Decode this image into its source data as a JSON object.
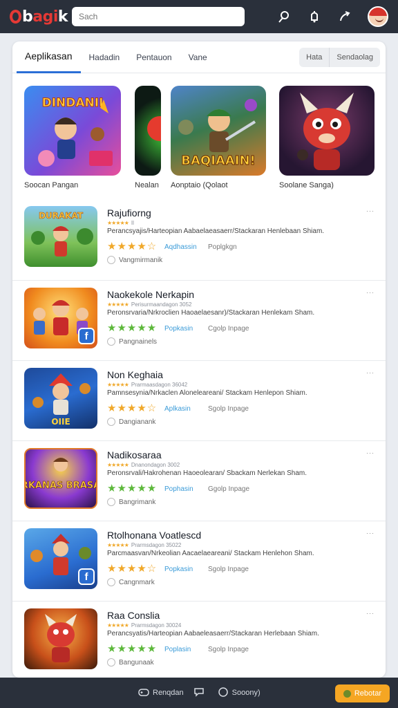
{
  "header": {
    "logo_prefix": "b",
    "logo_red": "agi",
    "logo_suffix": "k",
    "search_placeholder": "Sach",
    "icons": [
      "location-pin-icon",
      "notification-bell-icon",
      "share-arrow-icon",
      "avatar"
    ]
  },
  "tabs": [
    "Aeplikasan",
    "Hadadin",
    "Pentauon",
    "Vane"
  ],
  "active_tab": 0,
  "view_toggle": [
    "Hata",
    "Sendaolag"
  ],
  "featured": [
    {
      "caption": "Soocan Pangan",
      "art_text": "DINDANII"
    },
    {
      "caption": "Nealan",
      "art_text": ""
    },
    {
      "caption": "Aonptaio (Qolaot",
      "art_text": "BAQIAAIN!"
    },
    {
      "caption": "Soolane Sanga)",
      "art_text": ""
    }
  ],
  "apps": [
    {
      "title": "Rajufiorng",
      "sub": "Il",
      "description": "Perancsyajis/Harteopian Aabaelaeasaerr/Stackaran Henlebaan Shiam.",
      "stars": "★★★★☆",
      "star_color": "#f0a82a",
      "category": "Aqdhassin",
      "extra": "Poplgkgn",
      "developer": "Vangmirmanik",
      "more": "···",
      "thumb_text": "DURAKAT",
      "badge": ""
    },
    {
      "title": "Naokekole Nerkapin",
      "sub": "Perisurmaandagon 3052",
      "description": "Peronsrvaria/Nrkroclien Haoaelaesanr)/Stackaran Henlekam Sham.",
      "stars": "★★★★★",
      "star_color": "#5cb83a",
      "category": "Popkasin",
      "extra": "Cgolp Inpage",
      "developer": "Pangnainels",
      "more": "···",
      "thumb_text": "",
      "badge": "f"
    },
    {
      "title": "Non Keghaia",
      "sub": "Prarmaasdagon 36042",
      "description": "Pamnsesynia/Nrkaclen Aloneleareani/ Stackam Henlepon Shiam.",
      "stars": "★★★★☆",
      "star_color": "#f0a82a",
      "category": "Aplkasin",
      "extra": "Sgolp Inpage",
      "developer": "Dangianank",
      "more": "···",
      "thumb_text": "OIIE",
      "badge": ""
    },
    {
      "title": "Nadikosaraa",
      "sub": "Dnanondagon 3002",
      "description": "Peronsrvali/Hakrohenan Haoeolearan/ Sbackam Nerlekan Sham.",
      "stars": "★★★★★",
      "star_color": "#5cb83a",
      "category": "Pophasin",
      "extra": "Ggolp Inpage",
      "developer": "Bangrimank",
      "more": "···",
      "thumb_text": "ARKANAS BRASAK",
      "badge": ""
    },
    {
      "title": "Rtolhonana Voatlescd",
      "sub": "Prarmsdagon 35022",
      "description": "Parcmaasvan/Nrkeolian Aacaelaeareani/ Stackam Henlehon Sham.",
      "stars": "★★★★☆",
      "star_color": "#f0a82a",
      "category": "Popkasin",
      "extra": "Sgolp Inpage",
      "developer": "Cangnmark",
      "more": "···",
      "thumb_text": "",
      "badge": "f"
    },
    {
      "title": "Raa Conslia",
      "sub": "Prarmsdagon 30024",
      "description": "Perancsyatis/Harteopian Aabaeleasaerr/Stackaran Herlebaan Shiam.",
      "stars": "★★★★★",
      "star_color": "#5cb83a",
      "category": "Poplasin",
      "extra": "Sgolp Inpage",
      "developer": "Bangunaak",
      "more": "···",
      "thumb_text": "",
      "badge": ""
    }
  ],
  "footer": {
    "items": [
      {
        "icon": "gamepad-icon",
        "label": "Renqdan"
      },
      {
        "icon": "chat-bubble-icon",
        "label": ""
      },
      {
        "icon": "search-circle-icon",
        "label": "Sooony)"
      }
    ],
    "button": "Rebotar"
  },
  "colors": {
    "topbar": "#2a303b",
    "accent_blue": "#2b6fd6",
    "link_blue": "#3a9bd8",
    "orange": "#f5a623",
    "logo_red": "#e53935"
  }
}
